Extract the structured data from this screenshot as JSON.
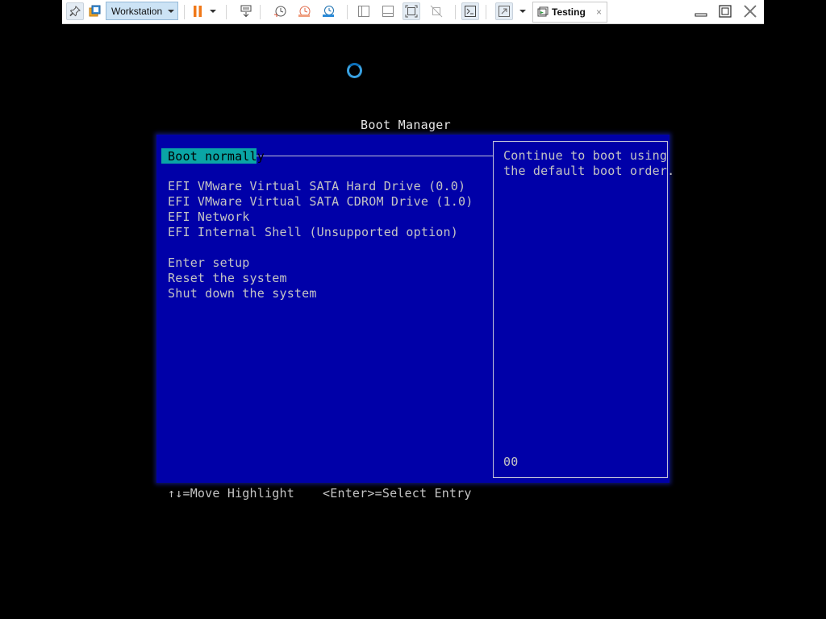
{
  "toolbar": {
    "workstation_label": "Workstation",
    "tab_title": "Testing",
    "tab_close_glyph": "×",
    "icons": [
      "pin-icon",
      "library-icon",
      "pause-icon",
      "send-keys-icon",
      "snapshot-icon",
      "revert-snapshot-icon",
      "snapshot-manager-icon",
      "sidebar-icon",
      "thumbnail-bar-icon",
      "fit-guest-icon",
      "disable-stretch-icon",
      "console-view-icon",
      "fullscreen-icon",
      "vm-tab-icon",
      "minimize-icon",
      "maximize-icon",
      "close-icon"
    ]
  },
  "boot_manager": {
    "title": "Boot Manager",
    "selected_item": "Boot normally",
    "devices": [
      "EFI VMware Virtual SATA Hard Drive (0.0)",
      "EFI VMware Virtual SATA CDROM Drive (1.0)",
      "EFI Network",
      "EFI Internal Shell (Unsupported option)"
    ],
    "actions": [
      "Enter setup",
      "Reset the system",
      "Shut down the system"
    ],
    "help_lines": [
      "Continue to boot using",
      "the default boot order."
    ],
    "help_code": "00",
    "footer": {
      "move_hint": "↑↓=Move Highlight",
      "select_hint": "<Enter>=Select Entry"
    }
  },
  "colors": {
    "panel_bg": "#0000a8",
    "selection_bg": "#0aa5a5",
    "text": "#c4c4c4",
    "pause_orange": "#f07818",
    "spinner_blue": "#38a0e0"
  }
}
